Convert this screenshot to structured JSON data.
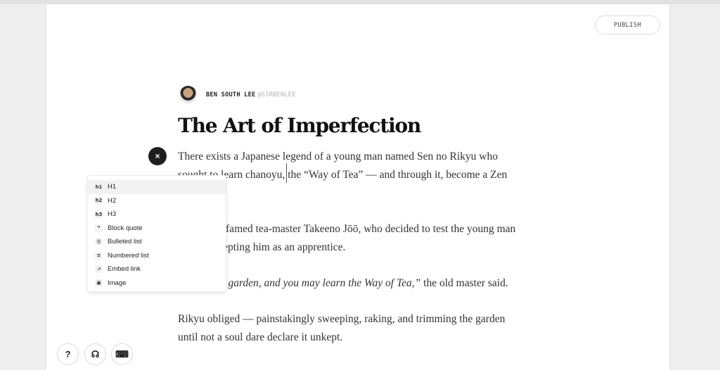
{
  "header": {
    "publish_label": "PUBLISH"
  },
  "author": {
    "name": "BEN SOUTH LEE",
    "handle": "@SIRBENLEE"
  },
  "article": {
    "title": "The Art of Imperfection",
    "p1_line1": "There exists a Japanese legend of a young man named Sen no Rikyu who",
    "p1_line2": "sought to learn chanoyu, the “Way of Tea” — and through it, become a Zen",
    "p2_line1": "sought the famed tea-master Takeeno Jōō, who decided to test the young man",
    "p2_line2": "before accepting him as an apprentice.",
    "p3_italic": "“Clean my garden, and you may learn the Way of Tea,”",
    "p3_rest": " the old master said.",
    "p4_line1": "Rikyu obliged — painstakingly sweeping, raking, and trimming the garden",
    "p4_line2": "until not a soul dare declare it unkept."
  },
  "insert_menu": {
    "close_icon": "×",
    "items": [
      {
        "icon": "h1",
        "label": "H1"
      },
      {
        "icon": "h2",
        "label": "H2"
      },
      {
        "icon": "h3",
        "label": "H3"
      },
      {
        "icon": "“",
        "label": "Block quote"
      },
      {
        "icon": "☰",
        "label": "Bulleted list"
      },
      {
        "icon": "≡",
        "label": "Numbered list"
      },
      {
        "icon": "↗",
        "label": "Embed link"
      },
      {
        "icon": "▣",
        "label": "Image"
      }
    ]
  },
  "footer": {
    "help_icon": "?",
    "headphones_icon": "☊",
    "keyboard_icon": "⌨"
  }
}
